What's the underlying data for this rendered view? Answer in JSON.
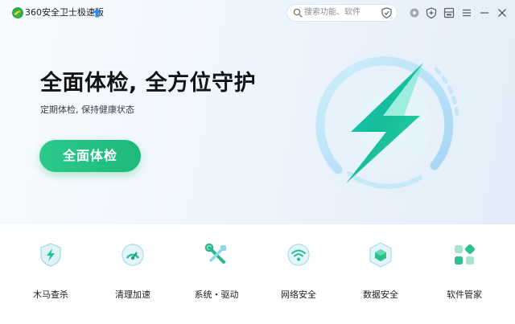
{
  "app": {
    "title": "360安全卫士极速版"
  },
  "search": {
    "placeholder": "搜索功能、软件"
  },
  "hero": {
    "headline": "全面体检, 全方位守护",
    "subline": "定期体检, 保持健康状态",
    "cta_label": "全面体检"
  },
  "tools": [
    {
      "label": "木马查杀",
      "icon": "trojan-scan-icon"
    },
    {
      "label": "清理加速",
      "icon": "cleanup-speed-icon"
    },
    {
      "label": "系统・驱动",
      "icon": "system-driver-icon"
    },
    {
      "label": "网络安全",
      "icon": "network-security-icon"
    },
    {
      "label": "数据安全",
      "icon": "data-security-icon"
    },
    {
      "label": "软件管家",
      "icon": "software-manager-icon"
    }
  ],
  "colors": {
    "brand_green": "#1fb97a",
    "accent_blue": "#2f80ed",
    "lightning": "#14c2b0"
  }
}
